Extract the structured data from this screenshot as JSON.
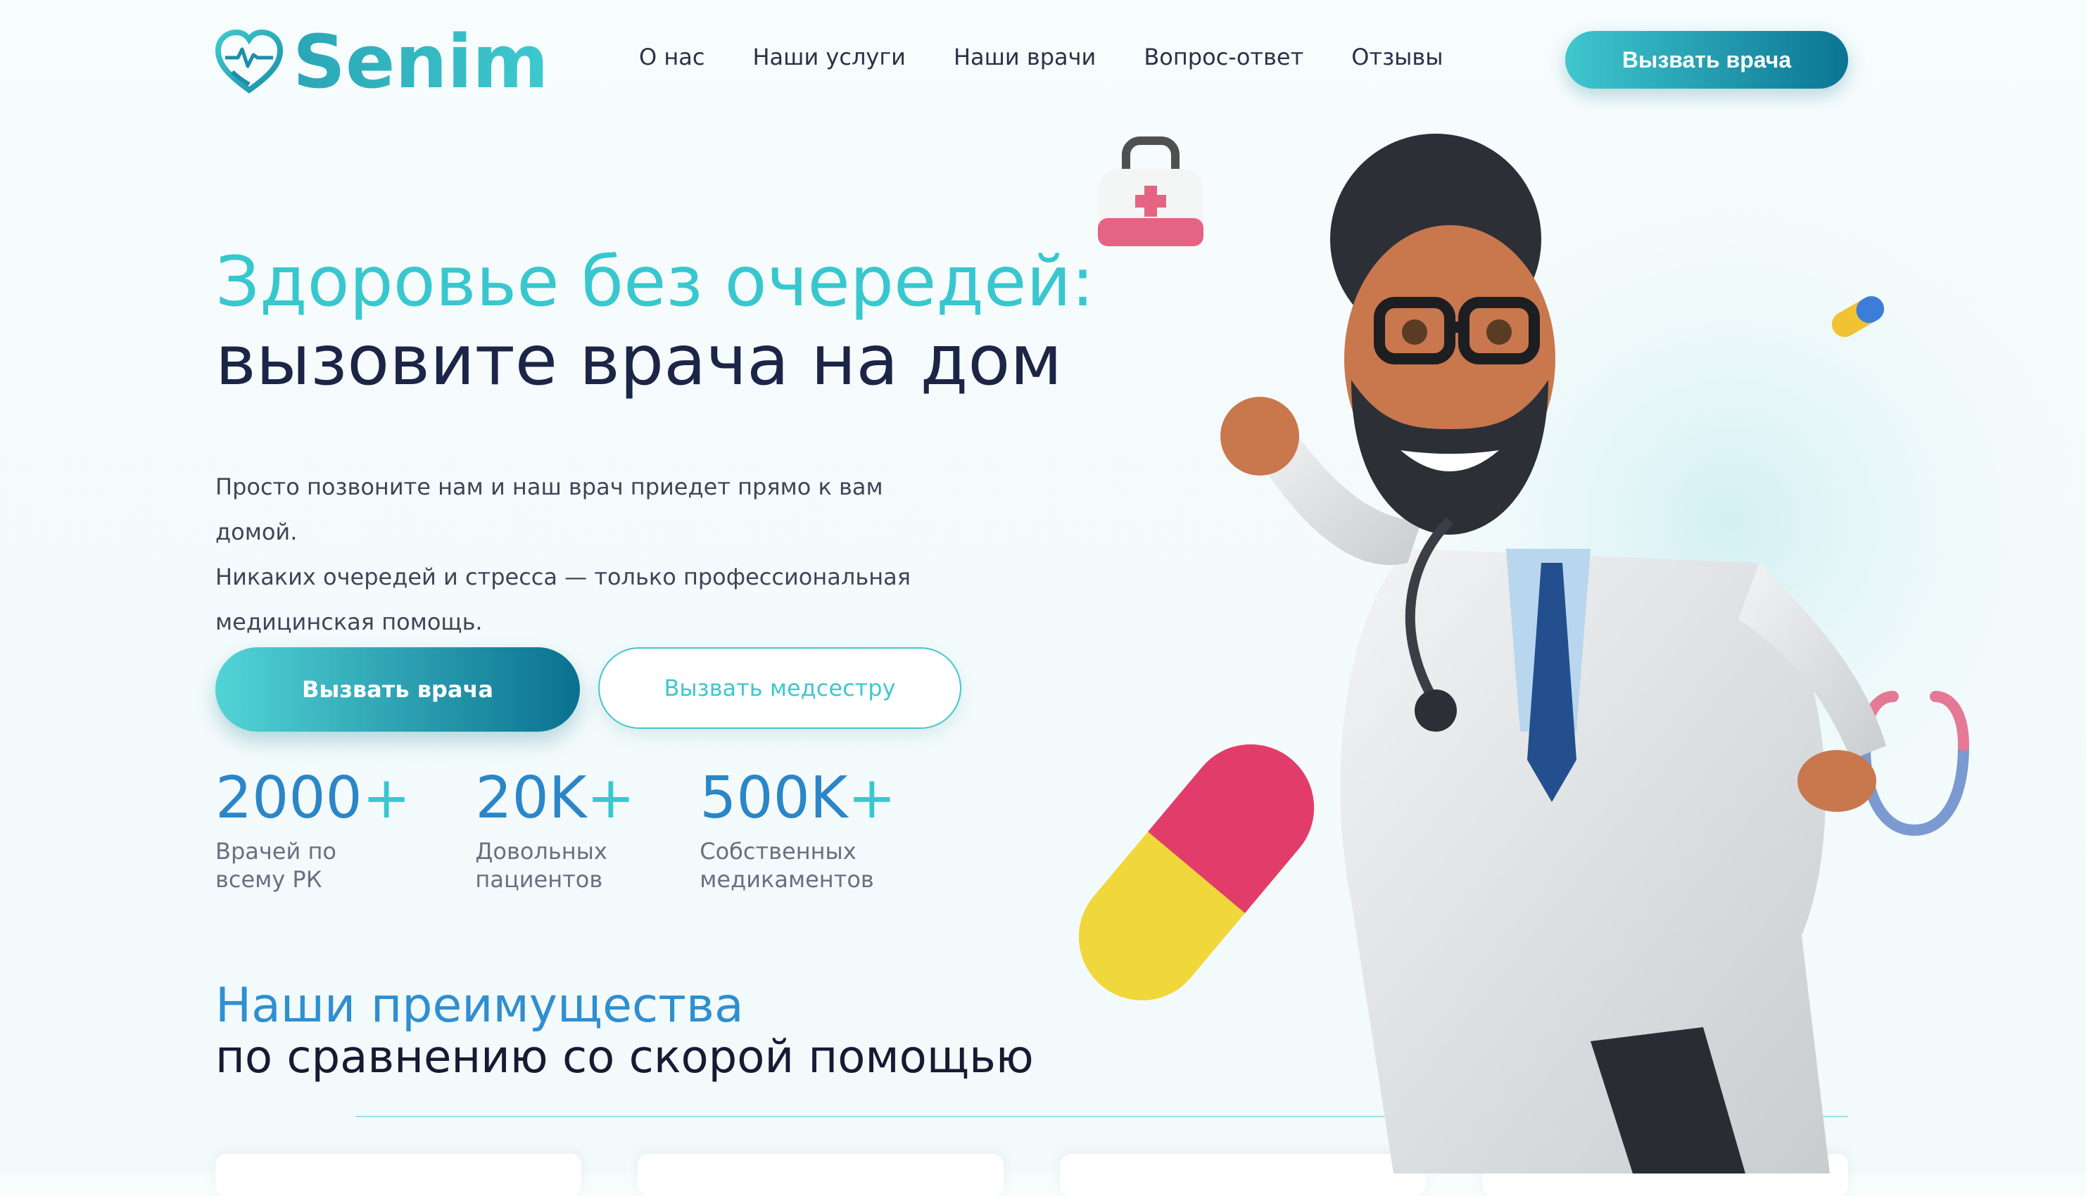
{
  "header": {
    "logo_text": "Senim",
    "nav": [
      "О нас",
      "Наши услуги",
      "Наши врачи",
      "Вопрос-ответ",
      "Отзывы"
    ],
    "cta_label": "Вызвать врача"
  },
  "hero": {
    "title_line1": "Здоровье без очередей:",
    "title_line2": "вызовите врача на дом",
    "description_lines": [
      "Просто позвоните нам и наш врач приедет прямо к вам домой.",
      "Никаких очередей и стресса — только профессиональная",
      "медицинская помощь."
    ],
    "primary_button": "Вызвать врача",
    "secondary_button": "Вызвать медсестру"
  },
  "stats": [
    {
      "value": "2000",
      "plus": "+",
      "label_lines": [
        "Врачей по",
        "всему РК"
      ]
    },
    {
      "value": "20K",
      "plus": "+",
      "label_lines": [
        "Довольных",
        "пациентов"
      ]
    },
    {
      "value": "500K",
      "plus": "+",
      "label_lines": [
        "Собственных",
        "медикаментов"
      ]
    }
  ],
  "advantages": {
    "title_line1": "Наши преимущества",
    "title_line2": "по сравнению со скорой помощью"
  },
  "colors": {
    "accent": "#39c7cf",
    "primary_dark": "#0b7593",
    "stat_blue": "#2b86c8",
    "heading_dark": "#1c2547"
  },
  "icons": {
    "logo": "heart-pulse-icon"
  }
}
